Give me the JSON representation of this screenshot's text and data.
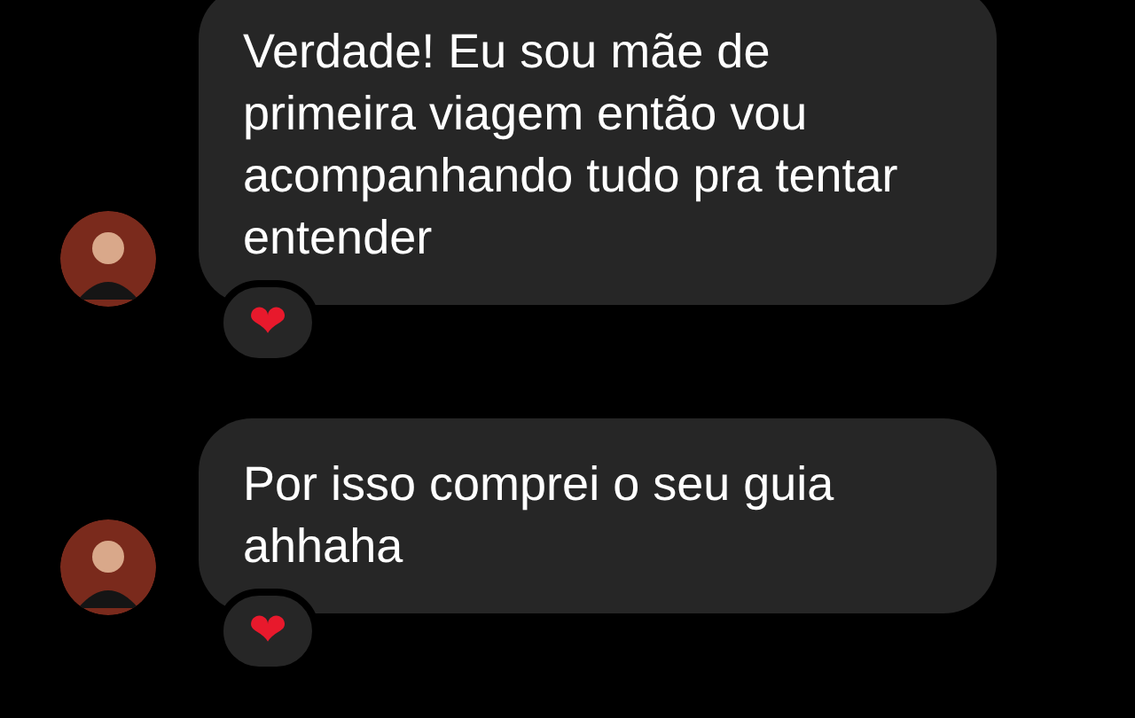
{
  "messages": [
    {
      "text": "Verdade! Eu sou mãe de primeira viagem então vou acompanhando tudo pra tentar entender",
      "avatar": true,
      "reaction": "❤"
    },
    {
      "text": "Por isso comprei o seu guia ahhaha",
      "avatar": true,
      "reaction": "❤"
    }
  ]
}
